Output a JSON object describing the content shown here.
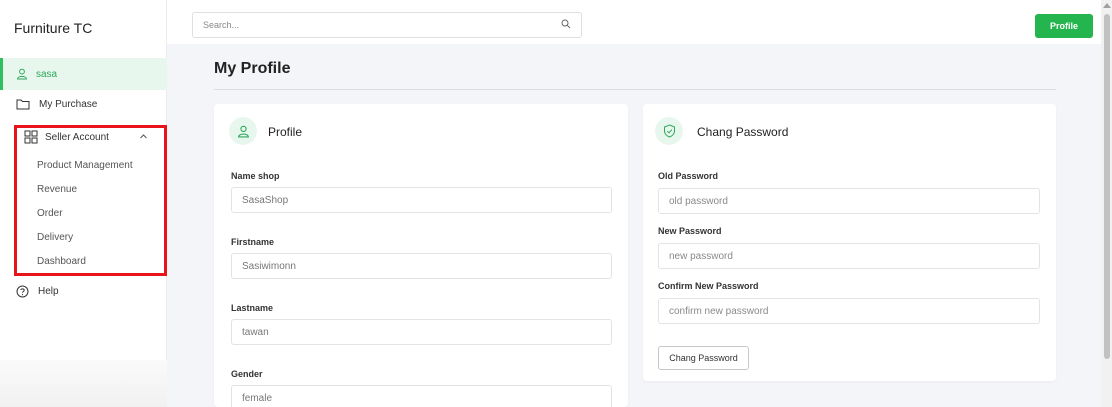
{
  "app": {
    "title": "Furniture TC"
  },
  "sidebar": {
    "user": "sasa",
    "purchase": "My Purchase",
    "seller_account": "Seller Account",
    "seller_items": [
      "Product Management",
      "Revenue",
      "Order",
      "Delivery",
      "Dashboard"
    ],
    "help": "Help"
  },
  "topbar": {
    "search_placeholder": "Search...",
    "profile_button": "Profile"
  },
  "page": {
    "title": "My Profile"
  },
  "profile_card": {
    "title": "Profile",
    "fields": [
      {
        "label": "Name shop",
        "value": "SasaShop"
      },
      {
        "label": "Firstname",
        "value": "Sasiwimonn"
      },
      {
        "label": "Lastname",
        "value": "tawan"
      },
      {
        "label": "Gender",
        "value": "female"
      }
    ]
  },
  "password_card": {
    "title": "Chang Password",
    "fields": [
      {
        "label": "Old Password",
        "placeholder": "old password"
      },
      {
        "label": "New Password",
        "placeholder": "new password"
      },
      {
        "label": "Confirm New Password",
        "placeholder": "confirm new password"
      }
    ],
    "button": "Chang Password"
  },
  "colors": {
    "accent": "#25b54f",
    "highlight_border": "#e8141a",
    "active_bg": "#e8f7ee"
  }
}
